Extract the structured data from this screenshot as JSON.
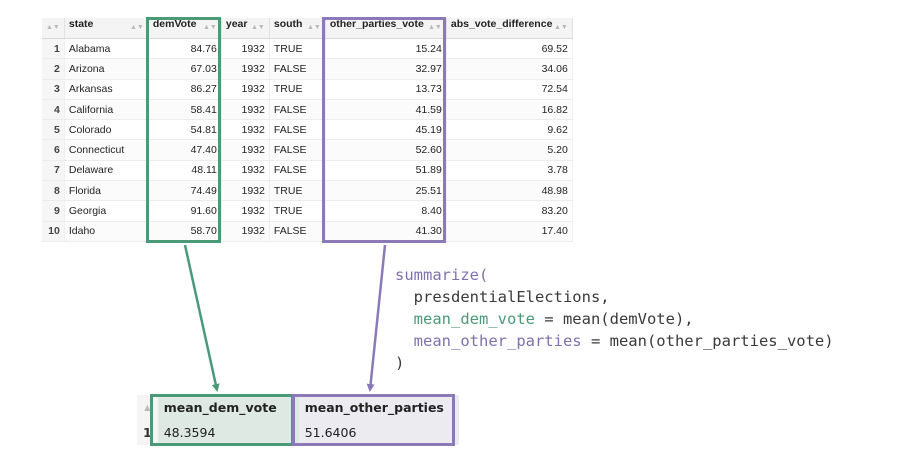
{
  "source_table": {
    "columns": [
      "state",
      "demVote",
      "year",
      "south",
      "other_parties_vote",
      "abs_vote_difference"
    ],
    "rows": [
      {
        "n": "1",
        "state": "Alabama",
        "demVote": "84.76",
        "year": "1932",
        "south": "TRUE",
        "other": "15.24",
        "diff": "69.52"
      },
      {
        "n": "2",
        "state": "Arizona",
        "demVote": "67.03",
        "year": "1932",
        "south": "FALSE",
        "other": "32.97",
        "diff": "34.06"
      },
      {
        "n": "3",
        "state": "Arkansas",
        "demVote": "86.27",
        "year": "1932",
        "south": "TRUE",
        "other": "13.73",
        "diff": "72.54"
      },
      {
        "n": "4",
        "state": "California",
        "demVote": "58.41",
        "year": "1932",
        "south": "FALSE",
        "other": "41.59",
        "diff": "16.82"
      },
      {
        "n": "5",
        "state": "Colorado",
        "demVote": "54.81",
        "year": "1932",
        "south": "FALSE",
        "other": "45.19",
        "diff": "9.62"
      },
      {
        "n": "6",
        "state": "Connecticut",
        "demVote": "47.40",
        "year": "1932",
        "south": "FALSE",
        "other": "52.60",
        "diff": "5.20"
      },
      {
        "n": "7",
        "state": "Delaware",
        "demVote": "48.11",
        "year": "1932",
        "south": "FALSE",
        "other": "51.89",
        "diff": "3.78"
      },
      {
        "n": "8",
        "state": "Florida",
        "demVote": "74.49",
        "year": "1932",
        "south": "TRUE",
        "other": "25.51",
        "diff": "48.98"
      },
      {
        "n": "9",
        "state": "Georgia",
        "demVote": "91.60",
        "year": "1932",
        "south": "TRUE",
        "other": "8.40",
        "diff": "83.20"
      },
      {
        "n": "10",
        "state": "Idaho",
        "demVote": "58.70",
        "year": "1932",
        "south": "FALSE",
        "other": "41.30",
        "diff": "17.40"
      }
    ]
  },
  "code": {
    "line1": "summarize(",
    "line2": "  presdentialElections,",
    "line3_name": "  mean_dem_vote",
    "line3_rest": " = mean(demVote),",
    "line4_name": "  mean_other_parties",
    "line4_rest": " = mean(other_parties_vote)",
    "line5": ")"
  },
  "result_table": {
    "columns": [
      "mean_dem_vote",
      "mean_other_parties"
    ],
    "row_number": "1",
    "values": [
      "48.3594",
      "51.6406"
    ]
  },
  "colors": {
    "green": "#4a9a78",
    "purple": "#8c7ab8"
  },
  "icons": {
    "sort": "sort-arrows-icon"
  }
}
